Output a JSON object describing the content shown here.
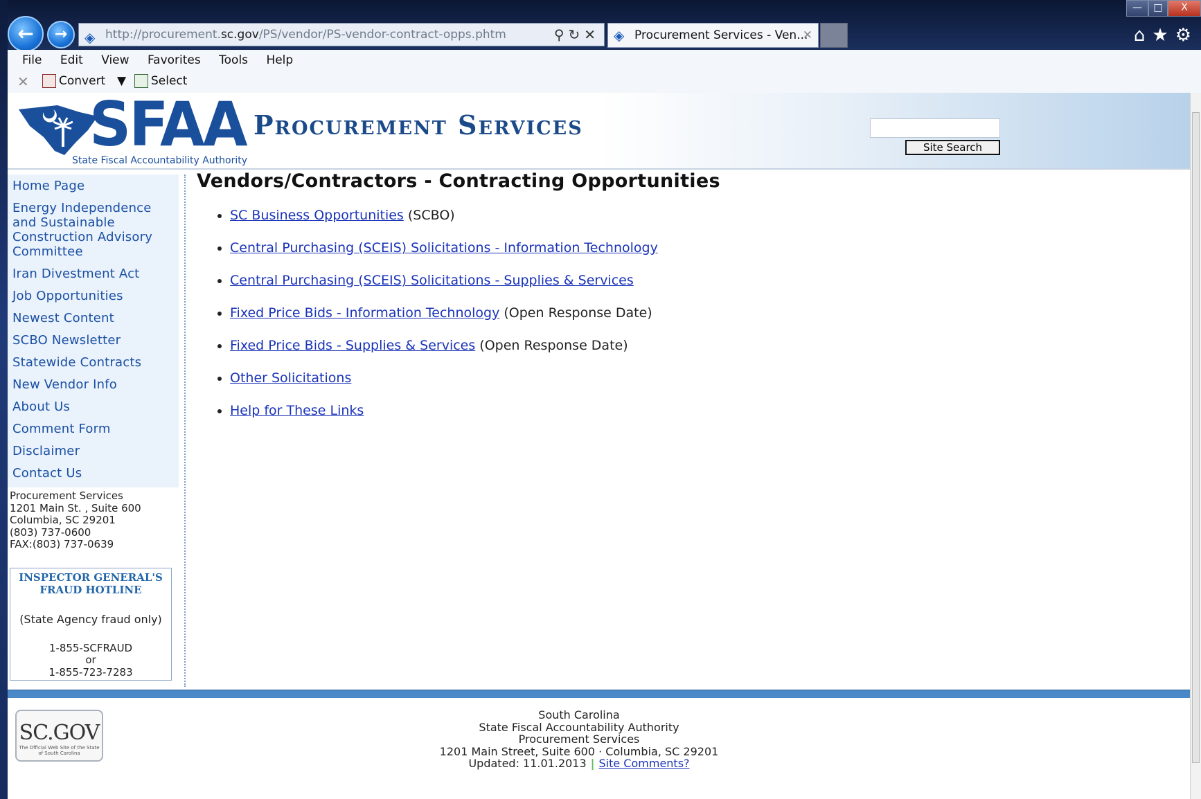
{
  "browser": {
    "url_prefix": "http://procurement.",
    "url_domain": "sc.gov",
    "url_path": "/PS/vendor/PS-vendor-contract-opps.phtm",
    "tab_title": "Procurement Services - Ven...",
    "win_controls": [
      "—",
      "□",
      "X"
    ]
  },
  "menubar": [
    "File",
    "Edit",
    "View",
    "Favorites",
    "Tools",
    "Help"
  ],
  "cmdbar": {
    "convert": "Convert",
    "select": "Select"
  },
  "header": {
    "logo_text": "SFAA",
    "logo_sub": "State Fiscal Accountability Authority",
    "title": "Procurement Services",
    "search_button": "Site Search"
  },
  "sidebar": {
    "items": [
      {
        "label": "Home Page"
      },
      {
        "label": "Energy Independence and Sustainable Construction Advisory Committee"
      },
      {
        "label": "Iran Divestment Act"
      },
      {
        "label": "Job Opportunities"
      },
      {
        "label": "Newest Content"
      },
      {
        "label": "SCBO Newsletter"
      },
      {
        "label": "Statewide Contracts"
      },
      {
        "label": "New Vendor Info"
      },
      {
        "label": "About Us"
      },
      {
        "label": "Comment Form"
      },
      {
        "label": "Disclaimer"
      },
      {
        "label": "Contact Us"
      }
    ],
    "address": {
      "name": "Procurement Services",
      "street": "1201 Main St. , Suite 600",
      "city": "Columbia, SC 29201",
      "phone": "(803) 737-0600",
      "fax": "FAX:(803) 737-0639"
    },
    "fraud": {
      "title_1": "INSPECTOR GENERAL'S",
      "title_2": "FRAUD HOTLINE",
      "scope": "(State Agency fraud only)",
      "phone_1": "1-855-SCFRAUD",
      "or": "or",
      "phone_2": "1-855-723-7283"
    }
  },
  "main": {
    "heading": "Vendors/Contractors - Contracting Opportunities",
    "links": [
      {
        "label": "SC Business Opportunities",
        "suffix": " (SCBO)"
      },
      {
        "label": "Central Purchasing (SCEIS) Solicitations - Information Technology",
        "suffix": ""
      },
      {
        "label": "Central Purchasing (SCEIS) Solicitations - Supplies & Services",
        "suffix": ""
      },
      {
        "label": "Fixed Price Bids - Information Technology",
        "suffix": " (Open Response Date)"
      },
      {
        "label": "Fixed Price Bids - Supplies & Services",
        "suffix": " (Open Response Date)"
      },
      {
        "label": "Other Solicitations",
        "suffix": ""
      },
      {
        "label": "Help for These Links",
        "suffix": ""
      }
    ]
  },
  "footer": {
    "logo_text": "SC.GOV",
    "logo_small": "The Official Web Site of the State of South Carolina",
    "line1": "South Carolina",
    "line2": "State Fiscal Accountability Authority",
    "line3": "Procurement Services",
    "line4": "1201 Main Street, Suite 600 · Columbia, SC 29201",
    "updated": "Updated: 11.01.2013",
    "site_comments": "Site Comments?"
  }
}
